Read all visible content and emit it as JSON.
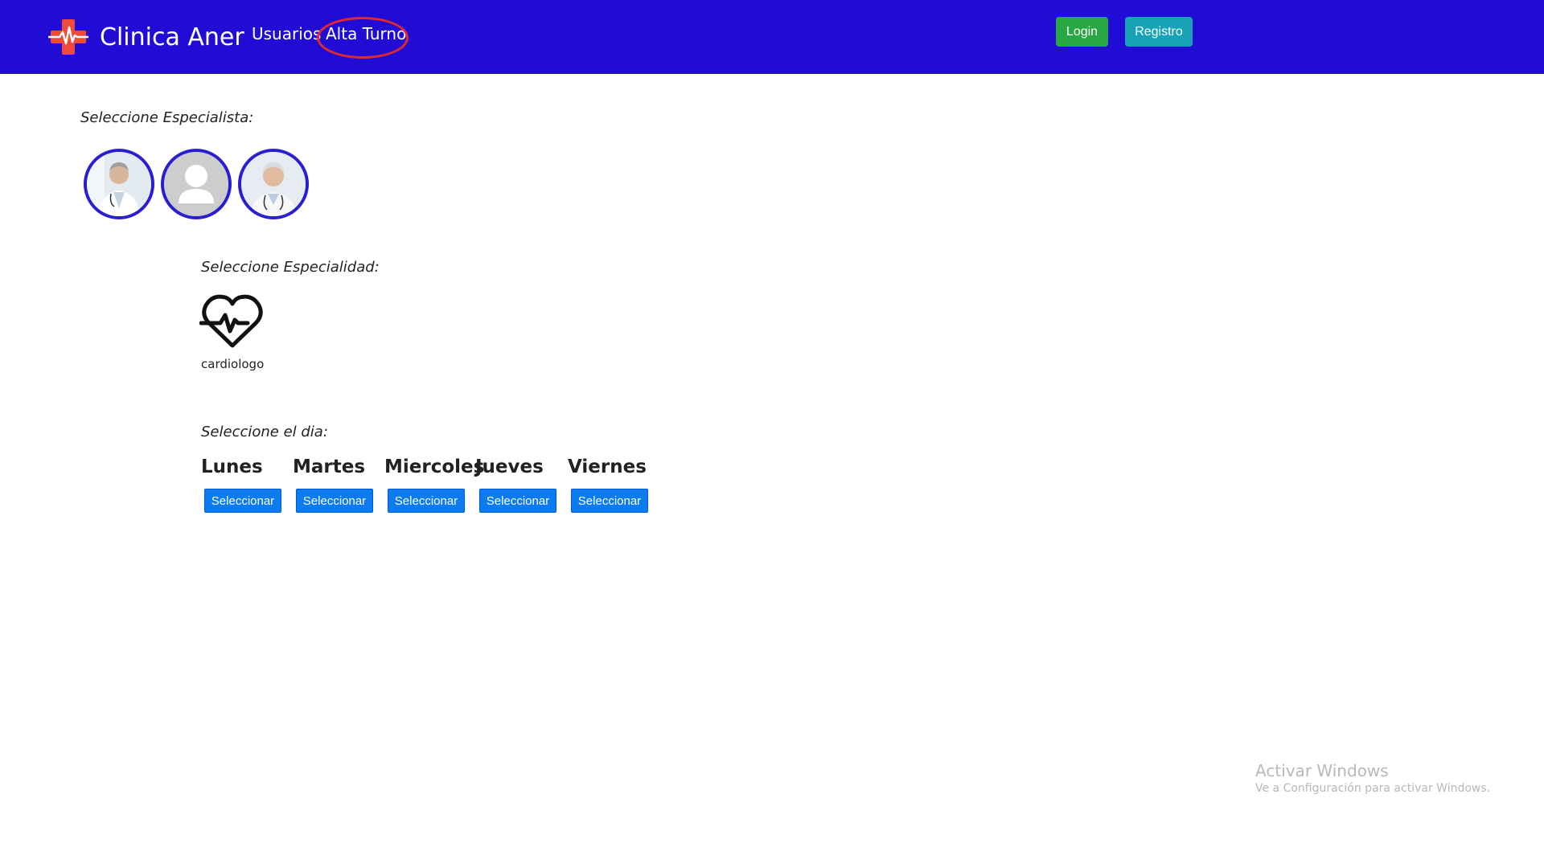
{
  "navbar": {
    "brand_name": "Clinica Aner",
    "links": [
      "Usuarios",
      "Alta Turno"
    ],
    "login_label": "Login",
    "registro_label": "Registro",
    "colors": {
      "background": "#210cd6",
      "login": "#28a745",
      "registro": "#17a2b8",
      "annotation": "#e0282f"
    },
    "icons": {
      "brand": "medical-cross-heartbeat-icon"
    }
  },
  "especialista": {
    "label": "Seleccione Especialista:",
    "avatars": [
      "doctor-photo-1",
      "default-user-icon",
      "doctor-photo-2"
    ]
  },
  "especialidad": {
    "label": "Seleccione Especialidad:",
    "items": [
      {
        "name": "cardiologo",
        "icon": "heart-pulse-icon"
      }
    ]
  },
  "dias": {
    "label": "Seleccione el dia:",
    "days": [
      {
        "name": "Lunes",
        "button": "Seleccionar"
      },
      {
        "name": "Martes",
        "button": "Seleccionar"
      },
      {
        "name": "Miercoles",
        "button": "Seleccionar"
      },
      {
        "name": "Jueves",
        "button": "Seleccionar"
      },
      {
        "name": "Viernes",
        "button": "Seleccionar"
      }
    ],
    "button_color": "#0b7bef"
  },
  "watermark": {
    "title": "Activar Windows",
    "subtitle": "Ve a Configuración para activar Windows."
  }
}
